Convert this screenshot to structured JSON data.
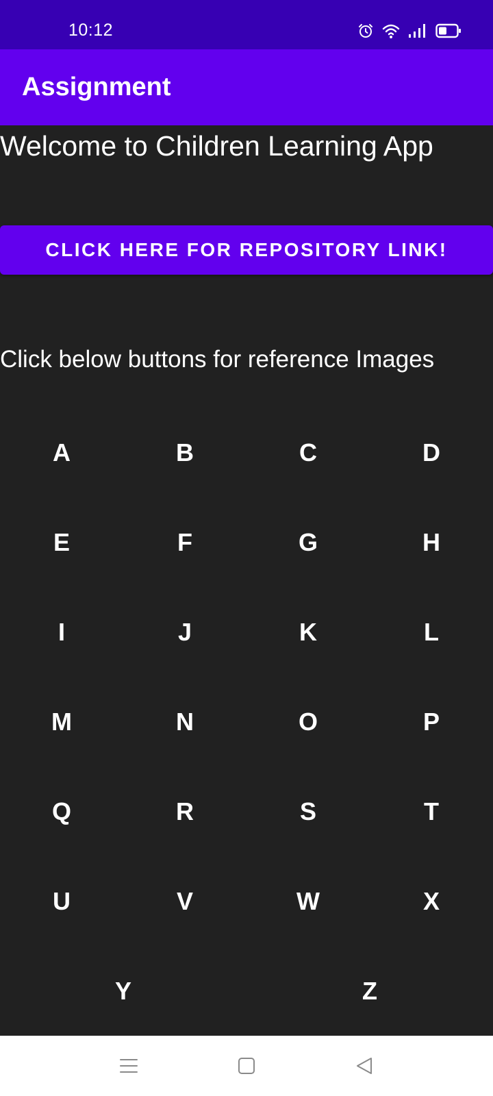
{
  "status_bar": {
    "time": "10:12",
    "icons": [
      "alarm-icon",
      "wifi-icon",
      "signal-icon",
      "battery-icon"
    ]
  },
  "app_bar": {
    "title": "Assignment"
  },
  "main": {
    "welcome_text": "Welcome to Children Learning App",
    "repo_button_label": "CLICK HERE FOR REPOSITORY LINK!",
    "instruction_text": "Click below buttons for reference Images",
    "letters": [
      "A",
      "B",
      "C",
      "D",
      "E",
      "F",
      "G",
      "H",
      "I",
      "J",
      "K",
      "L",
      "M",
      "N",
      "O",
      "P",
      "Q",
      "R",
      "S",
      "T",
      "U",
      "V",
      "W",
      "X"
    ],
    "last_row_letters": [
      "Y",
      "Z"
    ]
  },
  "nav_bar": {
    "buttons": [
      "menu-icon",
      "home-icon",
      "back-icon"
    ]
  },
  "colors": {
    "status_bar": "#3700b3",
    "primary": "#6200ee",
    "background": "#212121",
    "text": "#ffffff",
    "nav_bar": "#ffffff"
  }
}
